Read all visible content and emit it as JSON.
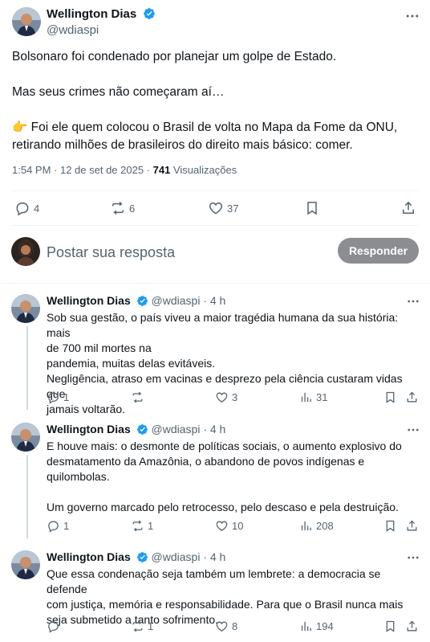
{
  "main_tweet": {
    "author_name": "Wellington Dias",
    "handle": "@wdiaspi",
    "lines": [
      "Bolsonaro foi condenado por planejar um golpe de Estado.",
      "",
      "Mas seus crimes não começaram aí…",
      "",
      "👉 Foi ele quem colocou o Brasil de volta no Mapa da Fome da ONU,",
      "retirando milhões de brasileiros do direito mais básico: comer."
    ],
    "time": "1:54 PM · 12 de set de 2025 · ",
    "views_count": "741",
    "views_label": "Visualizações",
    "replies": "4",
    "reposts": "6",
    "likes": "37"
  },
  "reply_composer": {
    "placeholder": "Postar sua resposta",
    "button": "Responder"
  },
  "thread": [
    {
      "author_name": "Wellington Dias",
      "handle": "@wdiaspi · 4 h",
      "lines": [
        "Sob sua gestão, o país viveu a maior tragédia humana da sua história: mais",
        "de 700 mil mortes na",
        "pandemia, muitas delas evitáveis.",
        "Negligência, atraso em vacinas e desprezo pela ciência custaram vidas que",
        "jamais voltarão."
      ],
      "replies": "1",
      "reposts": "",
      "likes": "3",
      "views": "31"
    },
    {
      "author_name": "Wellington Dias",
      "handle": "@wdiaspi · 4 h",
      "lines": [
        "E houve mais: o desmonte de políticas sociais, o aumento explosivo do",
        "desmatamento da Amazônia, o abandono de povos indígenas e",
        "quilombolas.",
        "",
        "Um governo marcado pelo retrocesso, pelo descaso e pela destruição."
      ],
      "replies": "1",
      "reposts": "1",
      "likes": "10",
      "views": "208"
    },
    {
      "author_name": "Wellington Dias",
      "handle": "@wdiaspi · 4 h",
      "lines": [
        "Que essa condenação seja também um lembrete: a democracia se defende",
        "com justiça, memória e responsabilidade. Para que o Brasil nunca mais",
        "seja submetido a tanto sofrimento."
      ],
      "replies": "",
      "reposts": "1",
      "likes": "8",
      "views": "194"
    }
  ],
  "colors": {
    "verified": "#1d9bf0",
    "muted": "#536471",
    "divider": "#eff3f4",
    "button_disabled": "#8b8d90"
  }
}
